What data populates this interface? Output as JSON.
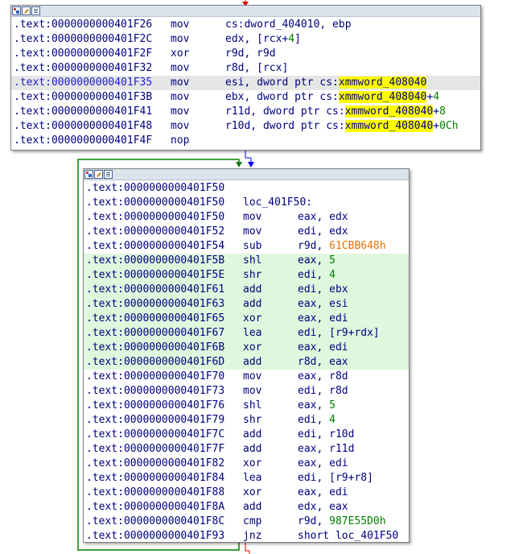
{
  "colors": {
    "node_border": "#7f7f7f",
    "header_bg": "#dbe3ec",
    "address_text": "#000080",
    "number": "#008000",
    "immediate": "#e87000",
    "highlight_ref": "#ffff00",
    "selected_line": "#e6e6e6",
    "highlighted_line": "#dff7dd",
    "edge_red": "#e00000",
    "edge_green": "#008000",
    "edge_blue": "#0000ff"
  },
  "header_icons": [
    "graph-view-icon",
    "edit-color-icon",
    "list-view-icon"
  ],
  "block1": {
    "lines": [
      {
        "seg": ".text:",
        "addr": "0000000000401F26",
        "mn": "mov",
        "parts": [
          {
            "t": "cs:dword_404010, ebp"
          }
        ]
      },
      {
        "seg": ".text:",
        "addr": "0000000000401F2C",
        "mn": "mov",
        "parts": [
          {
            "t": "edx, [rcx+"
          },
          {
            "t": "4",
            "c": "num"
          },
          {
            "t": "]"
          }
        ]
      },
      {
        "seg": ".text:",
        "addr": "0000000000401F2F",
        "mn": "xor",
        "parts": [
          {
            "t": "r9d, r9d"
          }
        ]
      },
      {
        "seg": ".text:",
        "addr": "0000000000401F32",
        "mn": "mov",
        "parts": [
          {
            "t": "r8d, [rcx]"
          }
        ]
      },
      {
        "seg": ".text:",
        "addr": "0000000000401F35",
        "mn": "mov",
        "parts": [
          {
            "t": "esi, dword ptr cs:"
          },
          {
            "t": "xmmword_408040",
            "c": "ref"
          }
        ],
        "selected": true
      },
      {
        "seg": ".text:",
        "addr": "0000000000401F3B",
        "mn": "mov",
        "parts": [
          {
            "t": "ebx, dword ptr cs:"
          },
          {
            "t": "xmmword_408040",
            "c": "ref"
          },
          {
            "t": "+"
          },
          {
            "t": "4",
            "c": "num"
          }
        ]
      },
      {
        "seg": ".text:",
        "addr": "0000000000401F41",
        "mn": "mov",
        "parts": [
          {
            "t": "r11d, dword ptr cs:"
          },
          {
            "t": "xmmword_408040",
            "c": "ref"
          },
          {
            "t": "+"
          },
          {
            "t": "8",
            "c": "num"
          }
        ]
      },
      {
        "seg": ".text:",
        "addr": "0000000000401F48",
        "mn": "mov",
        "parts": [
          {
            "t": "r10d, dword ptr cs:"
          },
          {
            "t": "xmmword_408040",
            "c": "ref"
          },
          {
            "t": "+"
          },
          {
            "t": "0Ch",
            "c": "num"
          }
        ]
      },
      {
        "seg": ".text:",
        "addr": "0000000000401F4F",
        "mn": "nop",
        "parts": []
      }
    ]
  },
  "block2": {
    "lines": [
      {
        "seg": ".text:",
        "addr": "0000000000401F50",
        "mn": "",
        "parts": []
      },
      {
        "seg": ".text:",
        "addr": "0000000000401F50",
        "label": "loc_401F50:",
        "mn": "",
        "parts": []
      },
      {
        "seg": ".text:",
        "addr": "0000000000401F50",
        "mn": "mov",
        "parts": [
          {
            "t": "eax, edx"
          }
        ]
      },
      {
        "seg": ".text:",
        "addr": "0000000000401F52",
        "mn": "mov",
        "parts": [
          {
            "t": "edi, edx"
          }
        ]
      },
      {
        "seg": ".text:",
        "addr": "0000000000401F54",
        "mn": "sub",
        "parts": [
          {
            "t": "r9d, "
          },
          {
            "t": "61CBB648h",
            "c": "imm"
          }
        ]
      },
      {
        "seg": ".text:",
        "addr": "0000000000401F5B",
        "mn": "shl",
        "parts": [
          {
            "t": "eax, "
          },
          {
            "t": "5",
            "c": "num"
          }
        ],
        "hl": true
      },
      {
        "seg": ".text:",
        "addr": "0000000000401F5E",
        "mn": "shr",
        "parts": [
          {
            "t": "edi, "
          },
          {
            "t": "4",
            "c": "num"
          }
        ],
        "hl": true
      },
      {
        "seg": ".text:",
        "addr": "0000000000401F61",
        "mn": "add",
        "parts": [
          {
            "t": "edi, ebx"
          }
        ],
        "hl": true
      },
      {
        "seg": ".text:",
        "addr": "0000000000401F63",
        "mn": "add",
        "parts": [
          {
            "t": "eax, esi"
          }
        ],
        "hl": true
      },
      {
        "seg": ".text:",
        "addr": "0000000000401F65",
        "mn": "xor",
        "parts": [
          {
            "t": "eax, edi"
          }
        ],
        "hl": true
      },
      {
        "seg": ".text:",
        "addr": "0000000000401F67",
        "mn": "lea",
        "parts": [
          {
            "t": "edi, [r9+rdx]"
          }
        ],
        "hl": true
      },
      {
        "seg": ".text:",
        "addr": "0000000000401F6B",
        "mn": "xor",
        "parts": [
          {
            "t": "eax, edi"
          }
        ],
        "hl": true
      },
      {
        "seg": ".text:",
        "addr": "0000000000401F6D",
        "mn": "add",
        "parts": [
          {
            "t": "r8d, eax"
          }
        ],
        "hl": true
      },
      {
        "seg": ".text:",
        "addr": "0000000000401F70",
        "mn": "mov",
        "parts": [
          {
            "t": "eax, r8d"
          }
        ]
      },
      {
        "seg": ".text:",
        "addr": "0000000000401F73",
        "mn": "mov",
        "parts": [
          {
            "t": "edi, r8d"
          }
        ]
      },
      {
        "seg": ".text:",
        "addr": "0000000000401F76",
        "mn": "shl",
        "parts": [
          {
            "t": "eax, "
          },
          {
            "t": "5",
            "c": "num"
          }
        ]
      },
      {
        "seg": ".text:",
        "addr": "0000000000401F79",
        "mn": "shr",
        "parts": [
          {
            "t": "edi, "
          },
          {
            "t": "4",
            "c": "num"
          }
        ]
      },
      {
        "seg": ".text:",
        "addr": "0000000000401F7C",
        "mn": "add",
        "parts": [
          {
            "t": "edi, r10d"
          }
        ]
      },
      {
        "seg": ".text:",
        "addr": "0000000000401F7F",
        "mn": "add",
        "parts": [
          {
            "t": "eax, r11d"
          }
        ]
      },
      {
        "seg": ".text:",
        "addr": "0000000000401F82",
        "mn": "xor",
        "parts": [
          {
            "t": "eax, edi"
          }
        ]
      },
      {
        "seg": ".text:",
        "addr": "0000000000401F84",
        "mn": "lea",
        "parts": [
          {
            "t": "edi, [r9+r8]"
          }
        ]
      },
      {
        "seg": ".text:",
        "addr": "0000000000401F88",
        "mn": "xor",
        "parts": [
          {
            "t": "eax, edi"
          }
        ]
      },
      {
        "seg": ".text:",
        "addr": "0000000000401F8A",
        "mn": "add",
        "parts": [
          {
            "t": "edx, eax"
          }
        ]
      },
      {
        "seg": ".text:",
        "addr": "0000000000401F8C",
        "mn": "cmp",
        "parts": [
          {
            "t": "r9d, "
          },
          {
            "t": "987E55D0h",
            "c": "num"
          }
        ]
      },
      {
        "seg": ".text:",
        "addr": "0000000000401F93",
        "mn": "jnz",
        "parts": [
          {
            "t": "short loc_401F50"
          }
        ]
      }
    ]
  }
}
